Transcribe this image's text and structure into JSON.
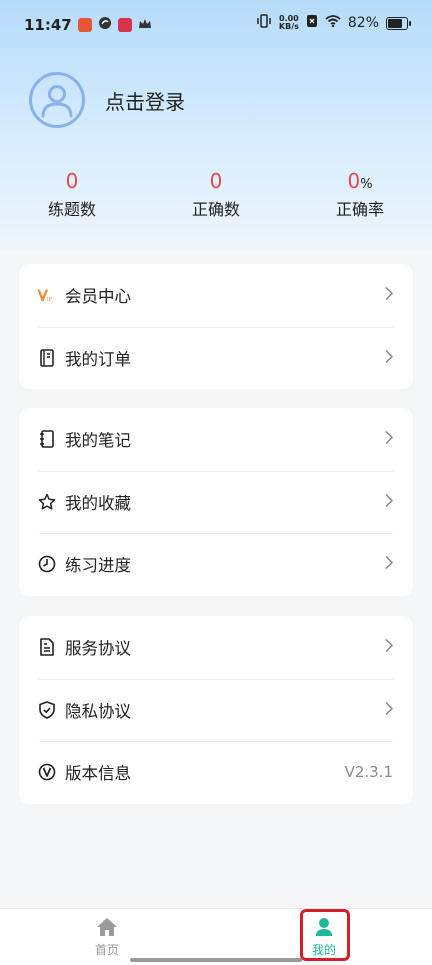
{
  "status_bar": {
    "time": "11:47",
    "net_speed_value": "0.00",
    "net_speed_unit": "KB/s",
    "battery_percent": "82%",
    "battery_level": 0.82
  },
  "profile": {
    "login_label": "点击登录"
  },
  "stats": [
    {
      "value": "0",
      "unit": "",
      "label": "练题数"
    },
    {
      "value": "0",
      "unit": "",
      "label": "正确数"
    },
    {
      "value": "0",
      "unit": "%",
      "label": "正确率"
    }
  ],
  "menu": {
    "group1": [
      {
        "label": "会员中心",
        "icon": "vip-icon"
      },
      {
        "label": "我的订单",
        "icon": "order-icon"
      }
    ],
    "group2": [
      {
        "label": "我的笔记",
        "icon": "notebook-icon"
      },
      {
        "label": "我的收藏",
        "icon": "star-icon"
      },
      {
        "label": "练习进度",
        "icon": "clock-icon"
      }
    ],
    "group3": [
      {
        "label": "服务协议",
        "icon": "document-icon"
      },
      {
        "label": "隐私协议",
        "icon": "shield-icon"
      },
      {
        "label": "版本信息",
        "icon": "version-icon",
        "value": "V2.3.1"
      }
    ]
  },
  "bottom_nav": [
    {
      "label": "首页",
      "icon": "home-icon",
      "active": false
    },
    {
      "label": "我的",
      "icon": "person-icon",
      "active": true
    }
  ],
  "colors": {
    "accent_red": "#e5484d",
    "nav_active": "#1fb89a",
    "nav_inactive": "#9a9a9a",
    "vip_orange": "#f08a3e"
  }
}
